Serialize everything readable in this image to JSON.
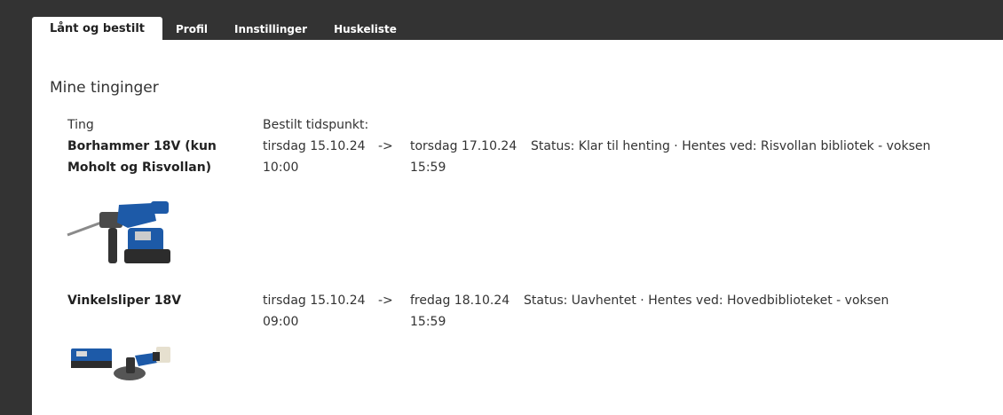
{
  "tabs": [
    "Lånt og bestilt",
    "Profil",
    "Innstillinger",
    "Huskeliste"
  ],
  "section_title": "Mine tinginger",
  "columns": {
    "item": "Ting",
    "ordered": "Bestilt tidspunkt:"
  },
  "reservations": [
    {
      "name": "Borhammer 18V (kun Moholt og Risvollan)",
      "from_date": "tirsdag 15.10.24",
      "from_time": "10:00",
      "arrow": "->",
      "to_date": "torsdag 17.10.24",
      "to_time": "15:59",
      "status": "Status: Klar til henting · Hentes ved: Risvollan bibliotek - voksen",
      "image_icon": "rotary-hammer-drill"
    },
    {
      "name": "Vinkelsliper 18V",
      "from_date": "tirsdag 15.10.24",
      "from_time": "09:00",
      "arrow": "->",
      "to_date": "fredag 18.10.24",
      "to_time": "15:59",
      "status": "Status: Uavhentet · Hentes ved: Hovedbiblioteket - voksen",
      "image_icon": "angle-grinder-with-case"
    }
  ],
  "colors": {
    "topbar": "#333333",
    "panel": "#ffffff",
    "tool_blue": "#1d5aa8"
  }
}
